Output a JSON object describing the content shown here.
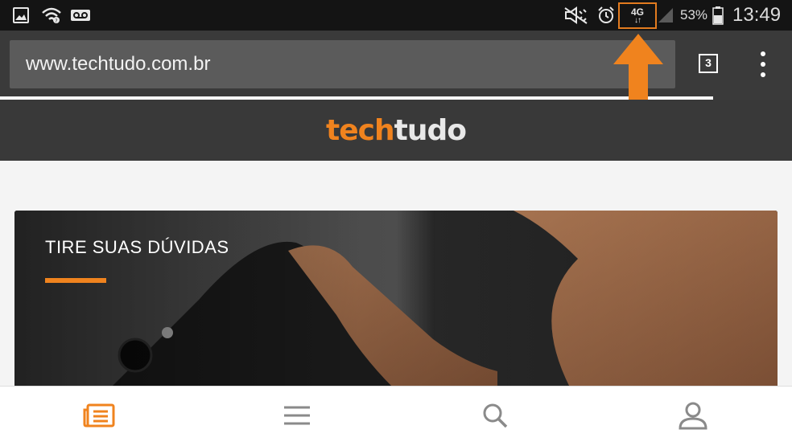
{
  "status_bar": {
    "icons": [
      "gallery-icon",
      "wifi-icon",
      "voicemail-icon",
      "mute-icon",
      "alarm-icon",
      "network-type-icon",
      "signal-icon",
      "battery-icon"
    ],
    "network_type": "4G",
    "network_activity": "↓↑",
    "battery_percent": "53%",
    "time": "13:49"
  },
  "browser": {
    "url": "www.techtudo.com.br",
    "tab_count": "3",
    "load_progress": 0.9
  },
  "annotation": {
    "arrow_color": "#f0831e",
    "highlight_color": "#e27b1f"
  },
  "site": {
    "logo_part1": "tech",
    "logo_part2": "tudo",
    "brand_color": "#f0831e"
  },
  "card": {
    "title": "TIRE SUAS DÚVIDAS"
  },
  "bottom_nav": {
    "items": [
      "news-icon",
      "menu-icon",
      "search-icon",
      "profile-icon"
    ],
    "active_color": "#f0831e",
    "inactive_color": "#8a8a8a"
  }
}
